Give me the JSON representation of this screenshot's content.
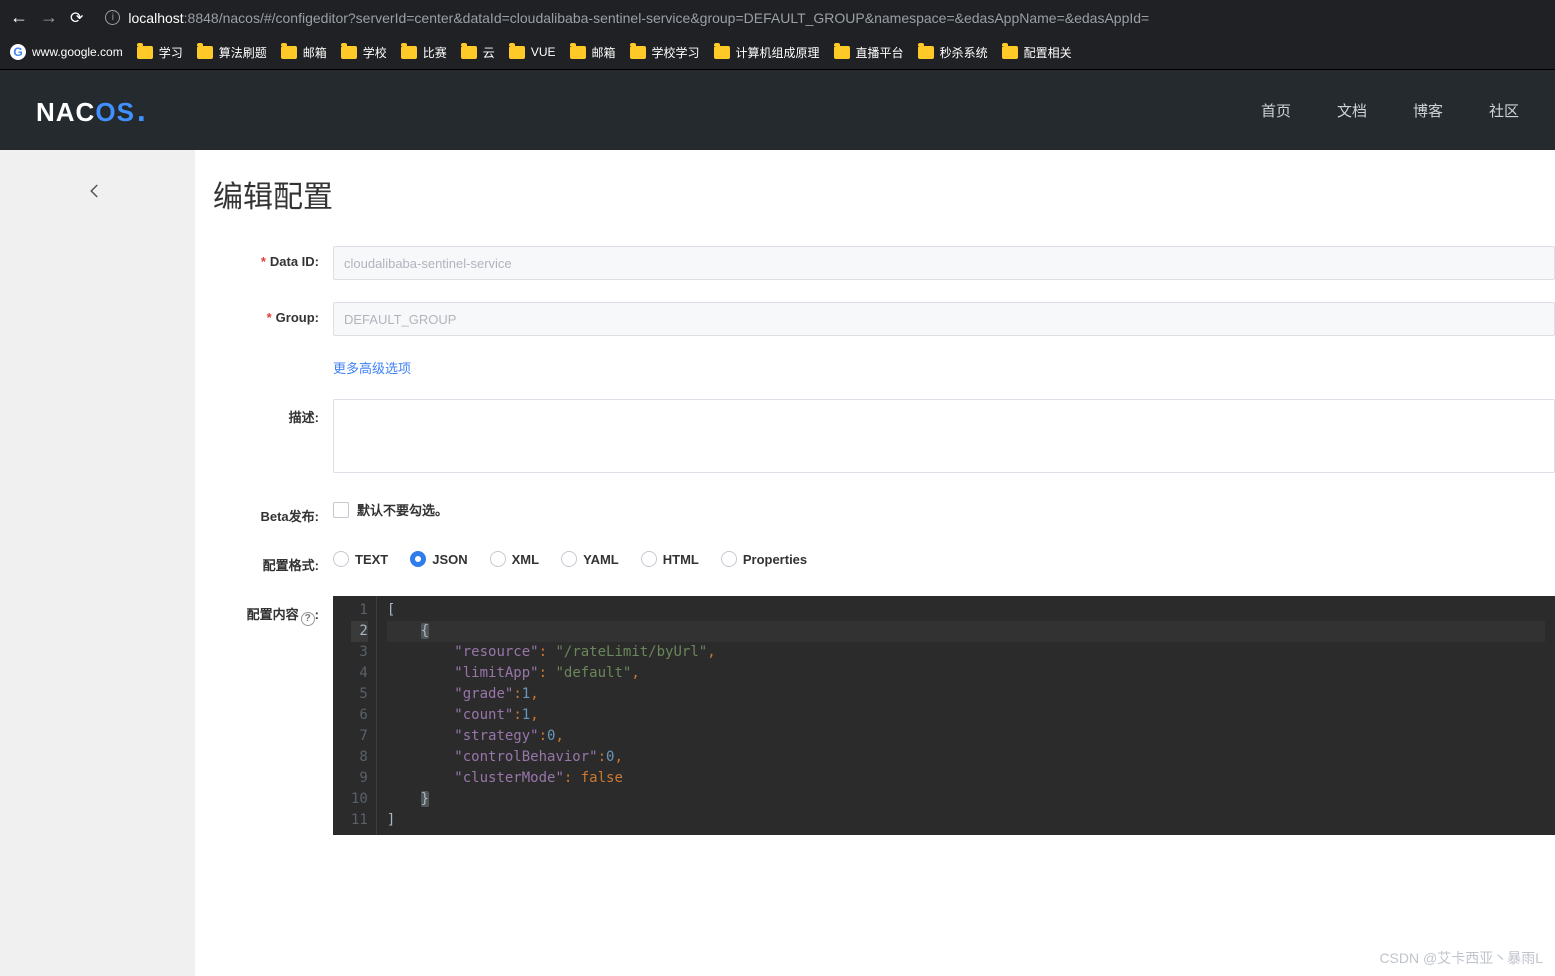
{
  "browser": {
    "url_host": "localhost",
    "url_rest": ":8848/nacos/#/configeditor?serverId=center&dataId=cloudalibaba-sentinel-service&group=DEFAULT_GROUP&namespace=&edasAppName=&edasAppId="
  },
  "bookmarks": {
    "google_label": "www.google.com",
    "items": [
      "学习",
      "算法刷题",
      "邮箱",
      "学校",
      "比赛",
      "云",
      "VUE",
      "邮箱",
      "学校学习",
      "计算机组成原理",
      "直播平台",
      "秒杀系统",
      "配置相关"
    ]
  },
  "nacos_nav": {
    "home": "首页",
    "docs": "文档",
    "blog": "博客",
    "community": "社区"
  },
  "page": {
    "title": "编辑配置"
  },
  "form": {
    "data_id_label": "Data ID:",
    "data_id_value": "cloudalibaba-sentinel-service",
    "group_label": "Group:",
    "group_value": "DEFAULT_GROUP",
    "advanced_link": "更多高级选项",
    "desc_label": "描述:",
    "desc_value": "",
    "beta_label": "Beta发布:",
    "beta_hint": "默认不要勾选。",
    "format_label": "配置格式:",
    "format_options": [
      "TEXT",
      "JSON",
      "XML",
      "YAML",
      "HTML",
      "Properties"
    ],
    "format_selected": "JSON",
    "content_label": "配置内容",
    "help_char": "?"
  },
  "editor": {
    "lines": [
      {
        "n": 1,
        "html": "<span class='tok-br'>[</span>"
      },
      {
        "n": 2,
        "html": "    <span class='cur-brace tok-br'>{</span>",
        "hl": true
      },
      {
        "n": 3,
        "html": "        <span class='tok-key'>\"resource\"</span><span class='tok-punc'>:</span> <span class='tok-str'>\"/rateLimit/byUrl\"</span><span class='tok-punc'>,</span>"
      },
      {
        "n": 4,
        "html": "        <span class='tok-key'>\"limitApp\"</span><span class='tok-punc'>:</span> <span class='tok-str'>\"default\"</span><span class='tok-punc'>,</span>"
      },
      {
        "n": 5,
        "html": "        <span class='tok-key'>\"grade\"</span><span class='tok-punc'>:</span><span class='tok-num'>1</span><span class='tok-punc'>,</span>"
      },
      {
        "n": 6,
        "html": "        <span class='tok-key'>\"count\"</span><span class='tok-punc'>:</span><span class='tok-num'>1</span><span class='tok-punc'>,</span>"
      },
      {
        "n": 7,
        "html": "        <span class='tok-key'>\"strategy\"</span><span class='tok-punc'>:</span><span class='tok-num'>0</span><span class='tok-punc'>,</span>"
      },
      {
        "n": 8,
        "html": "        <span class='tok-key'>\"controlBehavior\"</span><span class='tok-punc'>:</span><span class='tok-num'>0</span><span class='tok-punc'>,</span>"
      },
      {
        "n": 9,
        "html": "        <span class='tok-key'>\"clusterMode\"</span><span class='tok-punc'>:</span> <span class='tok-bool'>false</span>"
      },
      {
        "n": 10,
        "html": "    <span class='cur-brace tok-br'>}</span>"
      },
      {
        "n": 11,
        "html": "<span class='tok-br'>]</span>"
      }
    ]
  },
  "watermark": "CSDN @艾卡西亚丶暴雨L"
}
